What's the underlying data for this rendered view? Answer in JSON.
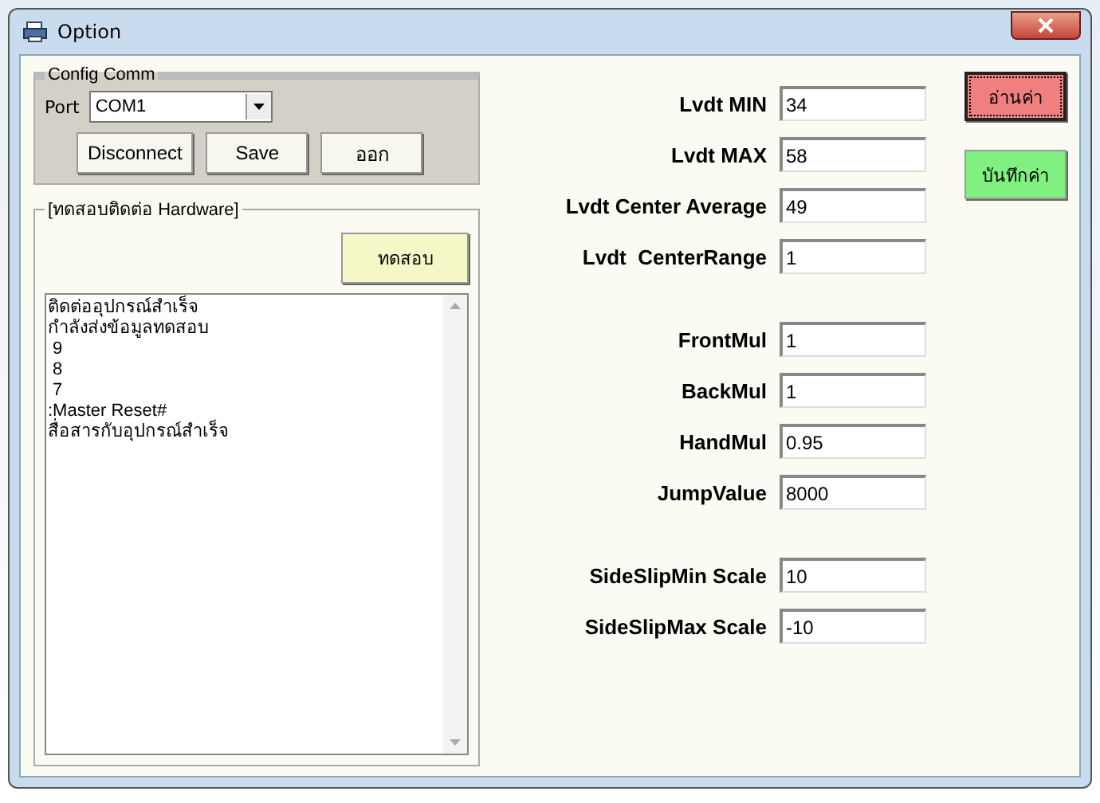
{
  "window": {
    "title": "Option"
  },
  "config_comm": {
    "title": "Config Comm",
    "port_label": "Port",
    "port_value": "COM1",
    "buttons": [
      "Disconnect",
      "Save",
      "ออก"
    ]
  },
  "hardware_test": {
    "title": "[ทดสอบติดต่อ Hardware]",
    "test_button": "ทดสอบ",
    "log": [
      "ติดต่ออุปกรณ์สำเร็จ",
      "กำลังส่งข้อมูลทดสอบ",
      " 9",
      " 8",
      " 7",
      ":Master Reset#",
      "สื่อสารกับอุปกรณ์สำเร็จ"
    ]
  },
  "field_groups": [
    [
      {
        "label": "Lvdt MIN",
        "value": "34"
      },
      {
        "label": "Lvdt MAX",
        "value": "58"
      },
      {
        "label": "Lvdt Center Average",
        "value": "49"
      },
      {
        "label": "Lvdt  CenterRange",
        "value": "1"
      }
    ],
    [
      {
        "label": "FrontMul",
        "value": "1"
      },
      {
        "label": "BackMul",
        "value": "1"
      },
      {
        "label": "HandMul",
        "value": "0.95"
      },
      {
        "label": "JumpValue",
        "value": "8000"
      }
    ],
    [
      {
        "label": "SideSlipMin Scale",
        "value": "10"
      },
      {
        "label": "SideSlipMax Scale",
        "value": "-10"
      }
    ]
  ],
  "action_buttons": [
    {
      "label": "อ่านค่า",
      "color": "#f08080"
    },
    {
      "label": "บันทึกค่า",
      "color": "#80f080"
    }
  ]
}
